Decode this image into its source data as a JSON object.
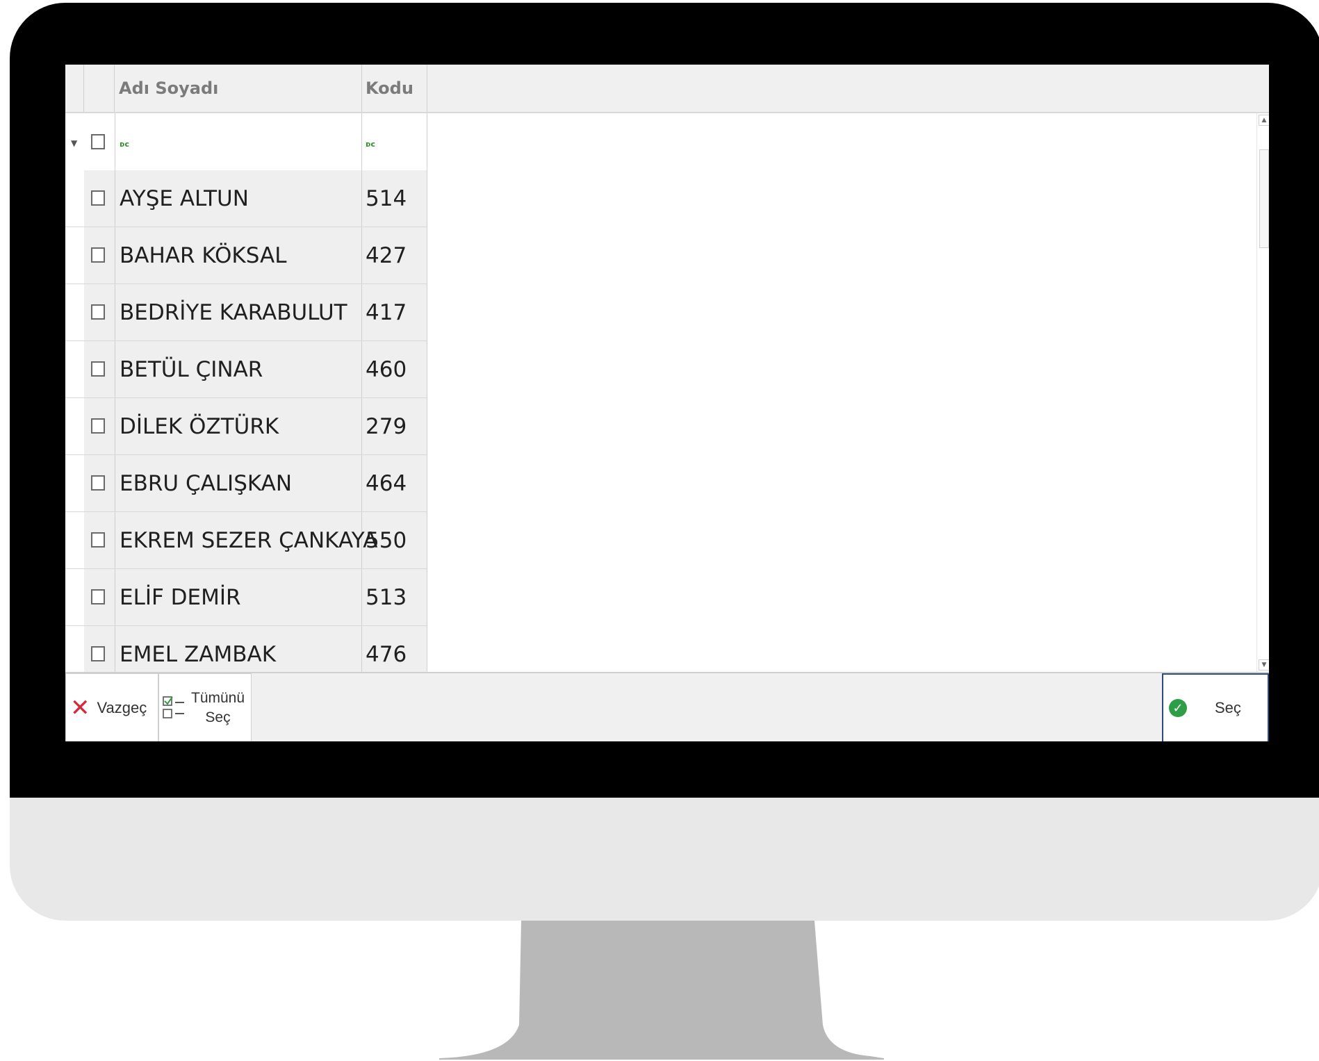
{
  "grid": {
    "columns": {
      "name": "Adı Soyadı",
      "code": "Kodu"
    },
    "filter_row": {
      "filter_symbol": "▼",
      "fx_name": "ᴅᴄ",
      "fx_code": "ᴅᴄ"
    },
    "rows": [
      {
        "name": "AYŞE ALTUN",
        "code": "514"
      },
      {
        "name": "BAHAR KÖKSAL",
        "code": "427"
      },
      {
        "name": "BEDRİYE KARABULUT",
        "code": "417"
      },
      {
        "name": "BETÜL ÇINAR",
        "code": "460"
      },
      {
        "name": "DİLEK ÖZTÜRK",
        "code": "279"
      },
      {
        "name": "EBRU ÇALIŞKAN",
        "code": "464"
      },
      {
        "name": "EKREM SEZER ÇANKAYA",
        "code": "550"
      },
      {
        "name": "ELİF DEMİR",
        "code": "513"
      },
      {
        "name": "EMEL ZAMBAK",
        "code": "476"
      }
    ]
  },
  "footer": {
    "cancel_label": "Vazgeç",
    "select_all_line1": "Tümünü",
    "select_all_line2": "Seç",
    "ok_label": "Seç"
  },
  "colors": {
    "cancel_icon": "#d62a3b",
    "ok_icon": "#2e9e46",
    "ok_border": "#2f4a78"
  },
  "icons": [
    "filter-icon",
    "close-icon",
    "select-all-icon",
    "check-circle-icon"
  ]
}
